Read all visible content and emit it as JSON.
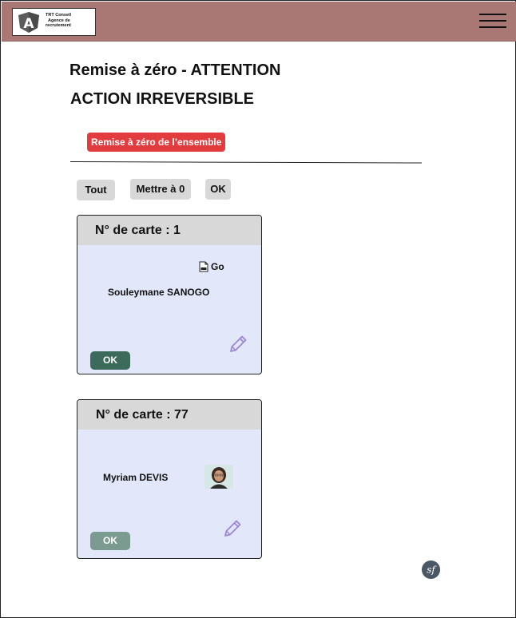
{
  "header": {
    "logo_lines": [
      "TRT Conseil",
      "Agence de",
      "recrutement"
    ],
    "logo_letter": "A",
    "colors": {
      "bar": "#a97774"
    }
  },
  "page": {
    "title_line1": "Remise à zéro - ATTENTION",
    "title_line2": "ACTION IRREVERSIBLE",
    "reset_all_label": "Remise à zéro de l’ensemble"
  },
  "filters": {
    "all_label": "Tout",
    "zero_label": "Mettre à 0",
    "ok_label": "OK"
  },
  "cards": [
    {
      "header": "N° de carte : 1",
      "name": "Souleymane SANOGO",
      "link_label": "Go",
      "link_icon": "pdf-file-icon",
      "ok_label": "OK",
      "ok_color": "#3d6b5b"
    },
    {
      "header": "N° de carte : 77",
      "name": "Myriam DEVIS",
      "photo": "profile-photo",
      "ok_label": "OK",
      "ok_color": "#7b9b91"
    }
  ],
  "footer": {
    "logo_icon": "symfony-logo-icon",
    "logo_text": "sf"
  },
  "colors": {
    "danger": "#e23c3f",
    "card_bg": "#e3e7fa",
    "pencil": "#9b86d4"
  }
}
